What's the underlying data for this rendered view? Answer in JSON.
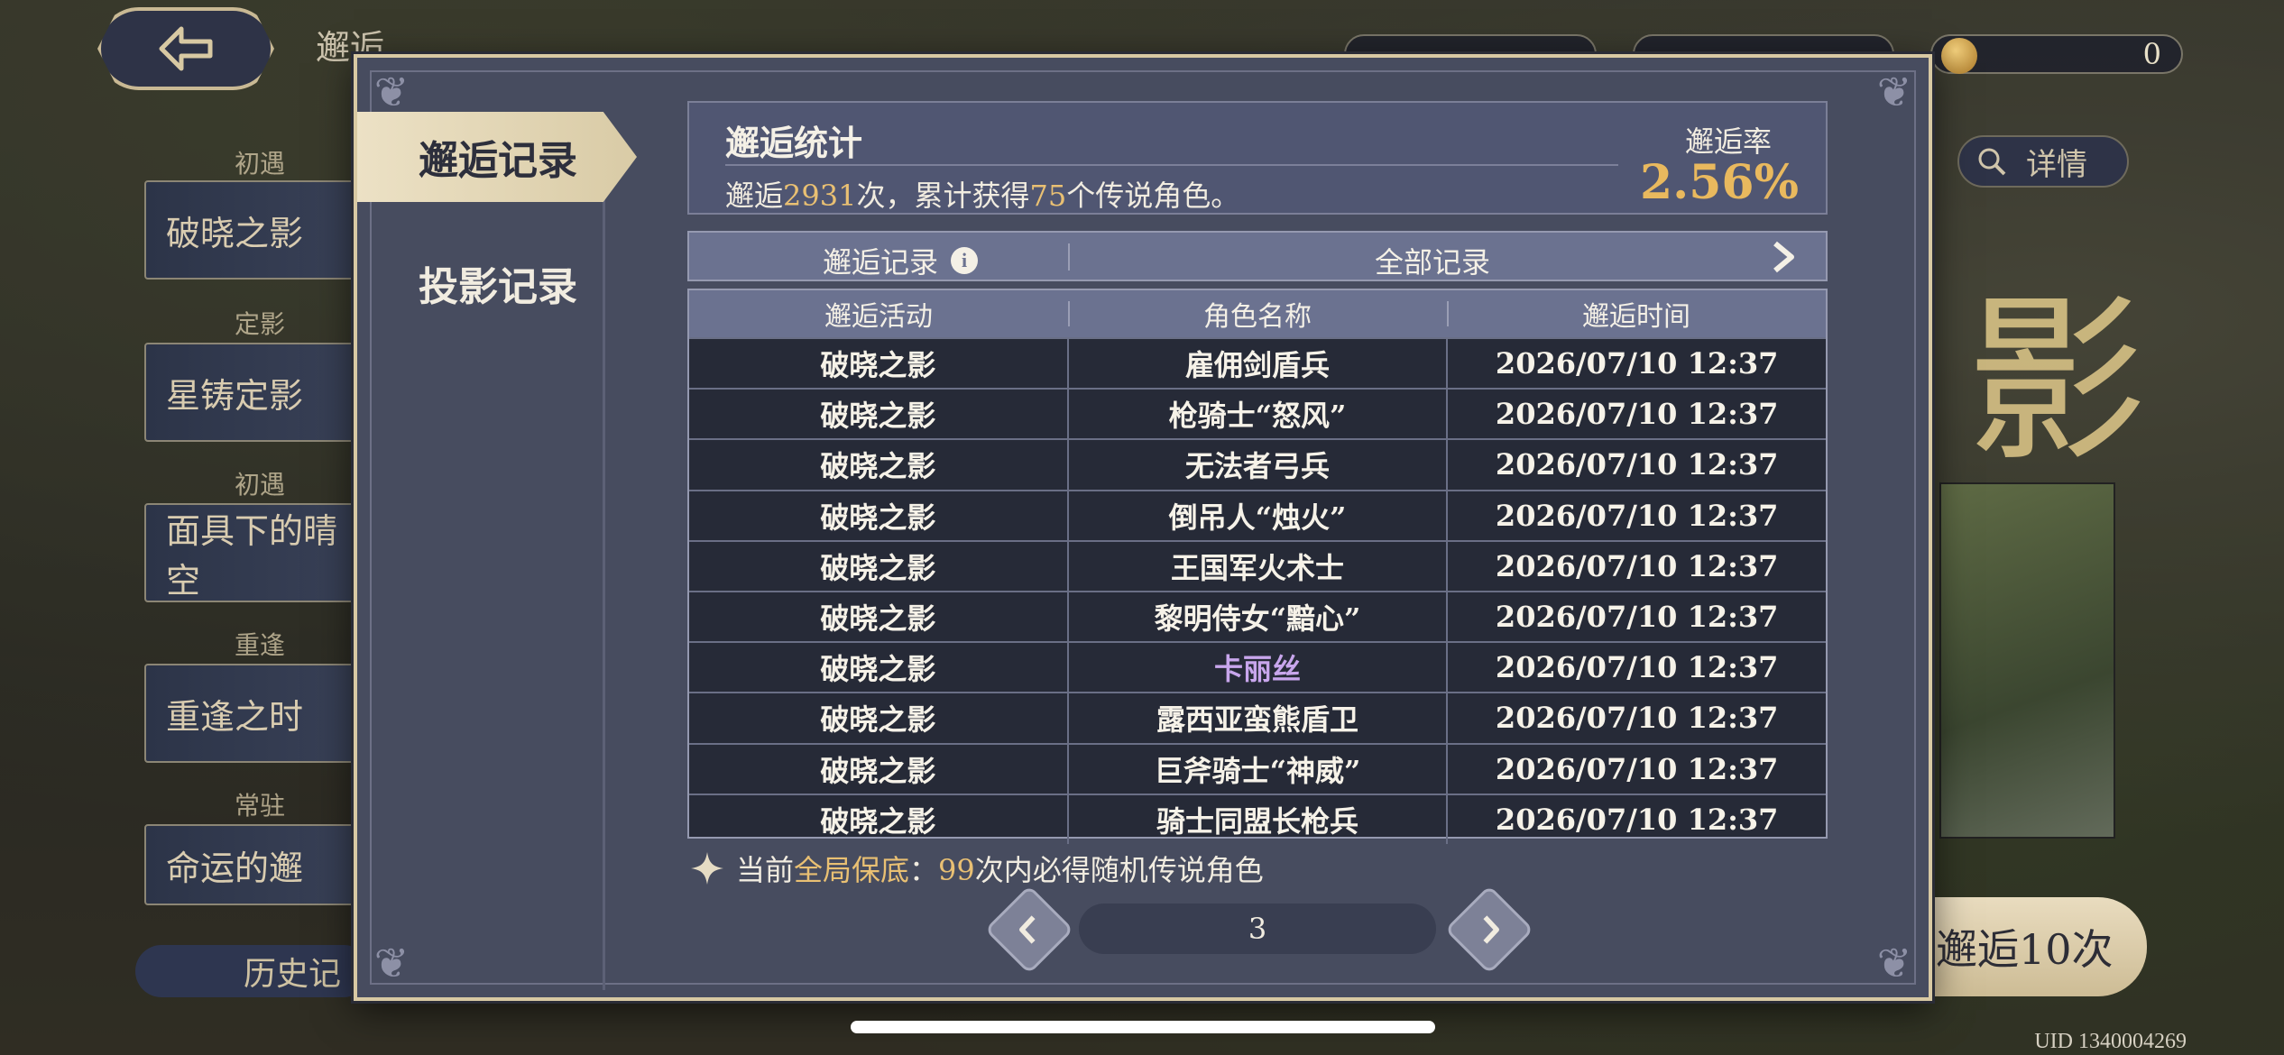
{
  "background": {
    "top_title": "邂逅",
    "resources": {
      "third_value": "0"
    },
    "side_tabs": [
      {
        "label": "初遇",
        "banner": "破晓之影"
      },
      {
        "label": "定影",
        "banner": "星铸定影"
      },
      {
        "label": "初遇",
        "banner": "面具下的晴空"
      },
      {
        "label": "重逢",
        "banner": "重逢之时"
      },
      {
        "label": "常驻",
        "banner": "命运的邂"
      }
    ],
    "history_button": "历史记",
    "detail_button": "详情",
    "summon_button": "邂逅10次",
    "big_logo": "影",
    "uid": "UID 1340004269"
  },
  "modal": {
    "tabs": {
      "active": "邂逅记录",
      "inactive": "投影记录"
    },
    "stats": {
      "title": "邂逅统计",
      "prefix": "邂逅",
      "total_count": "2931",
      "mid_text": "次，累计获得",
      "legend_count": "75",
      "suffix": "个传说角色。",
      "rate_label": "邂逅率",
      "rate_value": "2.56%"
    },
    "filter": {
      "left_label": "邂逅记录",
      "right_label": "全部记录"
    },
    "table": {
      "headers": [
        "邂逅活动",
        "角色名称",
        "邂逅时间"
      ],
      "rows": [
        {
          "activity": "破晓之影",
          "name": "雇佣剑盾兵",
          "time": "2026/07/10 12:37"
        },
        {
          "activity": "破晓之影",
          "name": "枪骑士“怒风”",
          "time": "2026/07/10 12:37"
        },
        {
          "activity": "破晓之影",
          "name": "无法者弓兵",
          "time": "2026/07/10 12:37"
        },
        {
          "activity": "破晓之影",
          "name": "倒吊人“烛火”",
          "time": "2026/07/10 12:37"
        },
        {
          "activity": "破晓之影",
          "name": "王国军火术士",
          "time": "2026/07/10 12:37"
        },
        {
          "activity": "破晓之影",
          "name": "黎明侍女“黯心”",
          "time": "2026/07/10 12:37"
        },
        {
          "activity": "破晓之影",
          "name": "卡丽丝",
          "time": "2026/07/10 12:37",
          "rare": true
        },
        {
          "activity": "破晓之影",
          "name": "露西亚蛮熊盾卫",
          "time": "2026/07/10 12:37"
        },
        {
          "activity": "破晓之影",
          "name": "巨斧骑士“神威”",
          "time": "2026/07/10 12:37"
        },
        {
          "activity": "破晓之影",
          "name": "骑士同盟长枪兵",
          "time": "2026/07/10 12:37"
        }
      ]
    },
    "guarantee": {
      "prefix": "当前",
      "highlight": "全局保底",
      "colon": "：",
      "count": "99",
      "suffix": "次内必得随机传说角色"
    },
    "pagination": {
      "page": "3"
    }
  },
  "colors": {
    "highlight": "#e9c073",
    "rare_name": "#c8a6ec",
    "frame": "#d8c9a3"
  }
}
